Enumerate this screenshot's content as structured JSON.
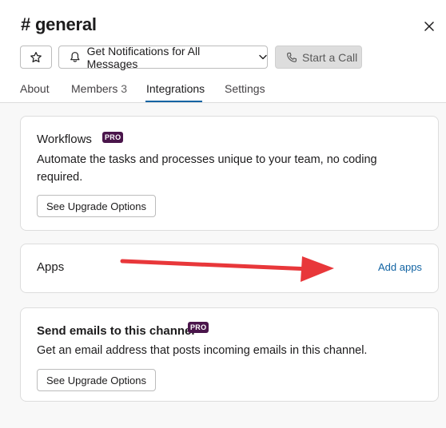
{
  "channel": {
    "title": "# general"
  },
  "toolbar": {
    "notifications_label": "Get Notifications for All Messages",
    "call_label": "Start a Call"
  },
  "tabs": [
    {
      "label": "About",
      "count": ""
    },
    {
      "label": "Members",
      "count": "3"
    },
    {
      "label": "Integrations",
      "count": "",
      "active": true
    },
    {
      "label": "Settings",
      "count": ""
    }
  ],
  "cards": {
    "workflows": {
      "title": "Workflows",
      "badge": "PRO",
      "description_line1": "Automate the tasks and processes unique to your team, no coding",
      "description_line2": "required.",
      "button_label": "See Upgrade Options"
    },
    "apps": {
      "title": "Apps",
      "link_label": "Add apps"
    },
    "emails": {
      "title": "Send emails to this channel",
      "badge": "PRO",
      "description": "Get an email address that posts incoming emails in this channel.",
      "button_label": "See Upgrade Options"
    }
  },
  "annotation": {
    "arrow_color": "#e8373a"
  },
  "colors": {
    "accent": "#1264a3",
    "pro_badge": "#4a154b"
  },
  "icons": [
    "star-icon",
    "bell-icon",
    "chevron-down-icon",
    "phone-icon",
    "close-icon"
  ]
}
